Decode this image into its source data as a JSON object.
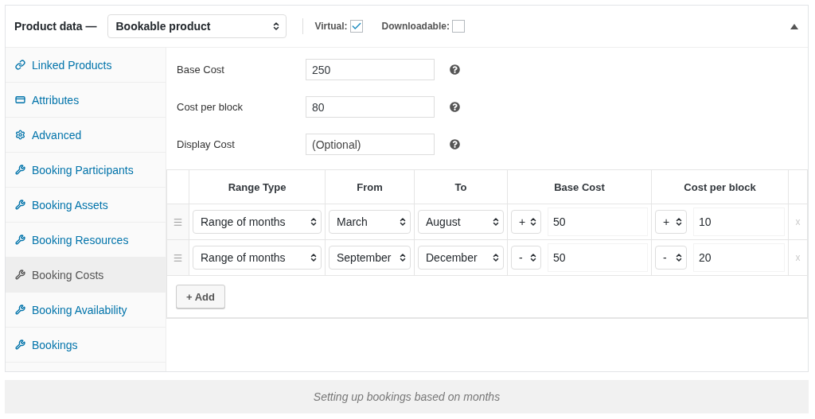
{
  "header": {
    "title": "Product data —",
    "product_type": "Bookable product",
    "options": [
      {
        "label": "Virtual:",
        "checked": true
      },
      {
        "label": "Downloadable:",
        "checked": false
      }
    ]
  },
  "sidebar": {
    "items": [
      {
        "label": "Linked Products",
        "selected": false
      },
      {
        "label": "Attributes",
        "selected": false
      },
      {
        "label": "Advanced",
        "selected": false
      },
      {
        "label": "Booking Participants",
        "selected": false
      },
      {
        "label": "Booking Assets",
        "selected": false
      },
      {
        "label": "Booking Resources",
        "selected": false
      },
      {
        "label": "Booking Costs",
        "selected": true
      },
      {
        "label": "Booking Availability",
        "selected": false
      },
      {
        "label": "Bookings",
        "selected": false
      }
    ]
  },
  "fields": [
    {
      "label": "Base Cost",
      "value": "250"
    },
    {
      "label": "Cost per block",
      "value": "80"
    },
    {
      "label": "Display Cost",
      "placeholder": "(Optional)"
    }
  ],
  "table": {
    "columns": [
      "Range Type",
      "From",
      "To",
      "Base Cost",
      "Cost per block"
    ],
    "rows": [
      {
        "range_type": "Range of months",
        "from": "March",
        "to": "August",
        "base_modifier": "+",
        "base_cost": "50",
        "block_modifier": "+",
        "block_cost": "10",
        "remove": "x"
      },
      {
        "range_type": "Range of months",
        "from": "September",
        "to": "December",
        "base_modifier": "-",
        "base_cost": "50",
        "block_modifier": "-",
        "block_cost": "20",
        "remove": "x"
      }
    ],
    "add_button": "+ Add"
  },
  "caption": "Setting up bookings based on months"
}
